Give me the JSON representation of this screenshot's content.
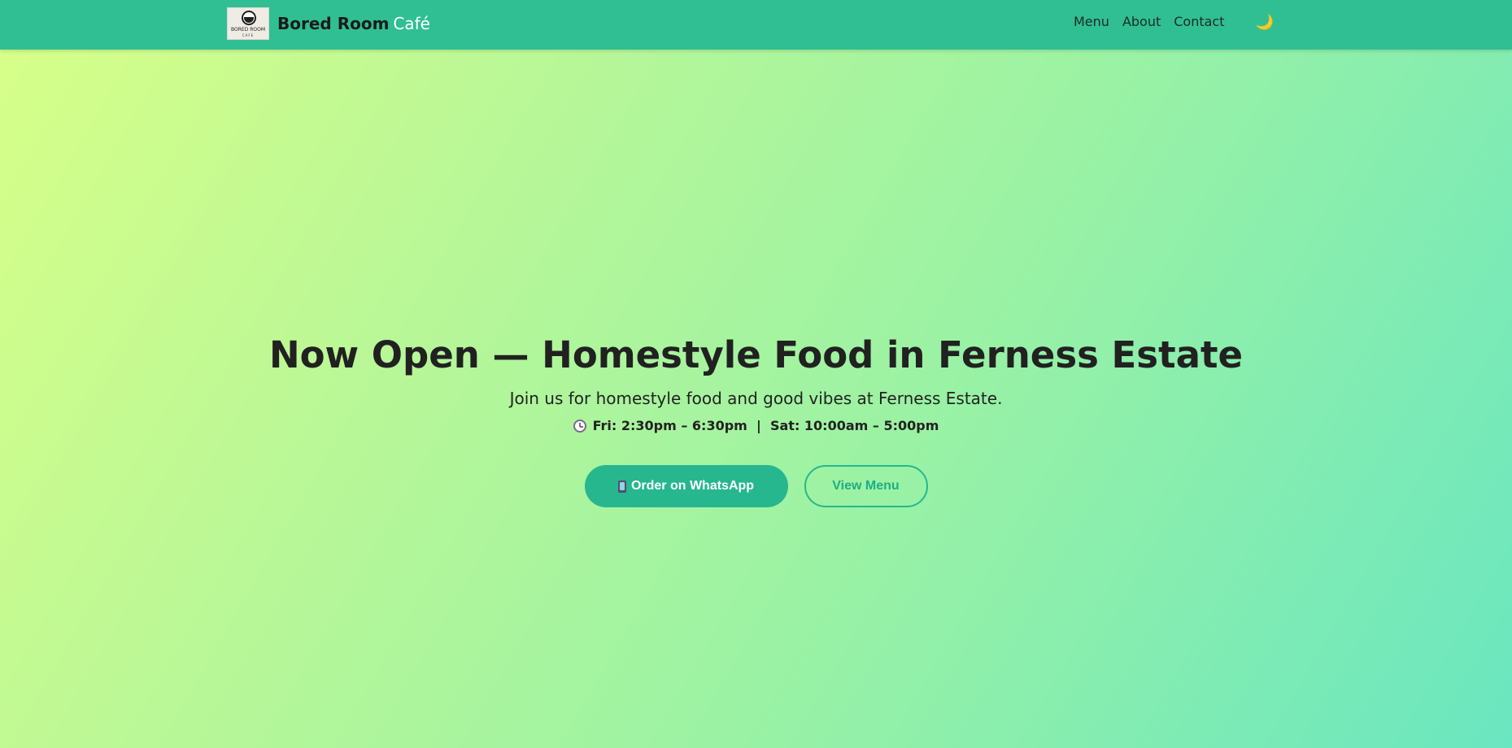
{
  "header": {
    "logo": {
      "text": "BORED ROOM",
      "sub": "CAFE"
    },
    "brand_name": "Bored Room",
    "brand_accent": "Café",
    "nav": {
      "menu": "Menu",
      "about": "About",
      "contact": "Contact"
    },
    "theme_toggle_icon": "moon-icon",
    "theme_toggle_glyph": "🌙"
  },
  "hero": {
    "title": "Now Open — Homestyle Food in Ferness Estate",
    "subtitle": "Join us for homestyle food and good vibes at Ferness Estate.",
    "hours_icon": "clock-icon",
    "hours": "Fri: 2:30pm – 6:30pm  |  Sat: 10:00am – 5:00pm",
    "primary_button": {
      "icon": "phone-icon",
      "label": "Order on WhatsApp"
    },
    "secondary_button": {
      "label": "View Menu"
    }
  },
  "colors": {
    "navbar": "#30bf93",
    "accent": "#26b78f",
    "gradient_start": "#d8ff88",
    "gradient_end": "#6ae6c0"
  }
}
